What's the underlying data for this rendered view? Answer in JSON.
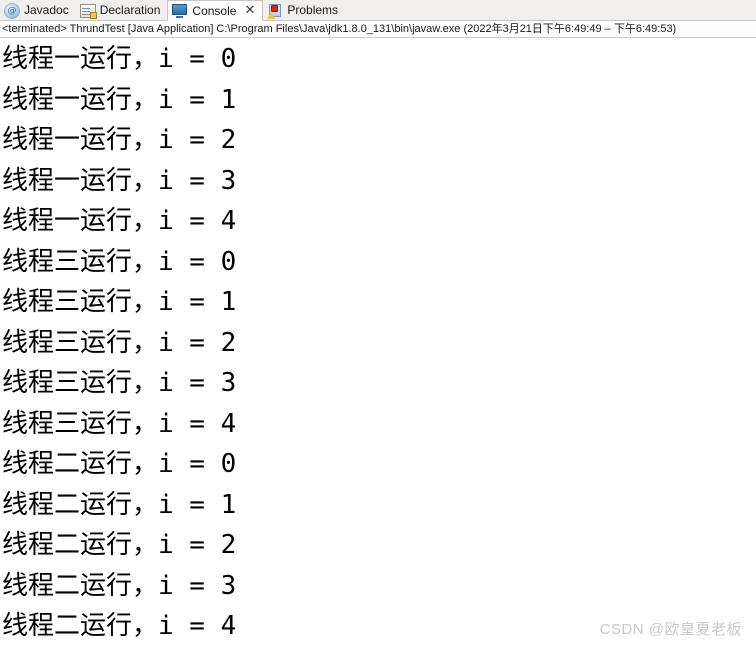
{
  "tabs": [
    {
      "label": "Javadoc",
      "icon": "javadoc-at-icon",
      "active": false,
      "closable": false
    },
    {
      "label": "Declaration",
      "icon": "declaration-icon",
      "active": false,
      "closable": false
    },
    {
      "label": "Console",
      "icon": "console-monitor-icon",
      "active": true,
      "closable": true,
      "close_glyph": "✕"
    },
    {
      "label": "Problems",
      "icon": "problems-warning-icon",
      "active": false,
      "closable": false
    }
  ],
  "status": {
    "text": "<terminated> ThrundTest [Java Application] C:\\Program Files\\Java\\jdk1.8.0_131\\bin\\javaw.exe  (2022年3月21日下午6:49:49 – 下午6:49:53)",
    "state": "<terminated>",
    "launch_name": "ThrundTest",
    "launch_type": "[Java Application]",
    "jvm_path": "C:\\Program Files\\Java\\jdk1.8.0_131\\bin\\javaw.exe",
    "timestamp": "(2022年3月21日下午6:49:49 – 下午6:49:53)"
  },
  "console": {
    "lines": [
      "线程一运行，i = 0",
      "线程一运行，i = 1",
      "线程一运行，i = 2",
      "线程一运行，i = 3",
      "线程一运行，i = 4",
      "线程三运行，i = 0",
      "线程三运行，i = 1",
      "线程三运行，i = 2",
      "线程三运行，i = 3",
      "线程三运行，i = 4",
      "线程二运行，i = 0",
      "线程二运行，i = 1",
      "线程二运行，i = 2",
      "线程二运行，i = 3",
      "线程二运行，i = 4"
    ]
  },
  "watermark": {
    "text": "CSDN @欧皇夏老板"
  },
  "colors": {
    "tabbar_bg": "#f0efee",
    "active_tab_bg": "#fdfdfd",
    "console_bg": "#ffffff",
    "text": "#000000",
    "watermark": "#c9c9c9"
  }
}
